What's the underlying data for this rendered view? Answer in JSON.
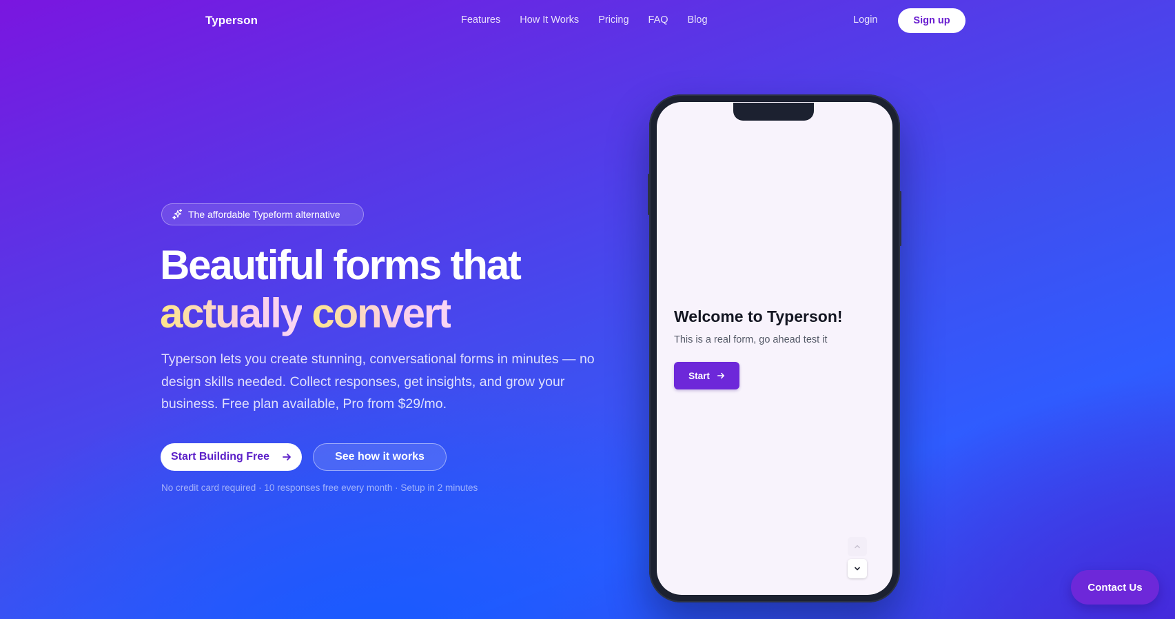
{
  "nav": {
    "logo": "Typerson",
    "links": [
      "Features",
      "How It Works",
      "Pricing",
      "FAQ",
      "Blog"
    ],
    "login": "Login",
    "signup": "Sign up"
  },
  "hero": {
    "badge": "The affordable Typeform alternative",
    "headline_line1": "Beautiful forms that",
    "headline_word_a": "actually",
    "headline_word_b": "convert",
    "description": "Typerson lets you create stunning, conversational forms in minutes — no design skills needed. Collect responses, get insights, and grow your business. Free plan available, Pro from $29/mo.",
    "primary_cta": "Start Building Free",
    "secondary_cta": "See how it works",
    "fineprint": "No credit card required · 10 responses free every month · Setup in 2 minutes"
  },
  "phone_form": {
    "title": "Welcome to Typerson!",
    "subtitle": "This is a real form, go ahead test it",
    "start_label": "Start"
  },
  "contact_label": "Contact Us",
  "colors": {
    "accent": "#6d28d9",
    "primary_text": "#5b1fc8",
    "highlight_start": "#fde68a",
    "highlight_end": "#fbcfe8"
  }
}
